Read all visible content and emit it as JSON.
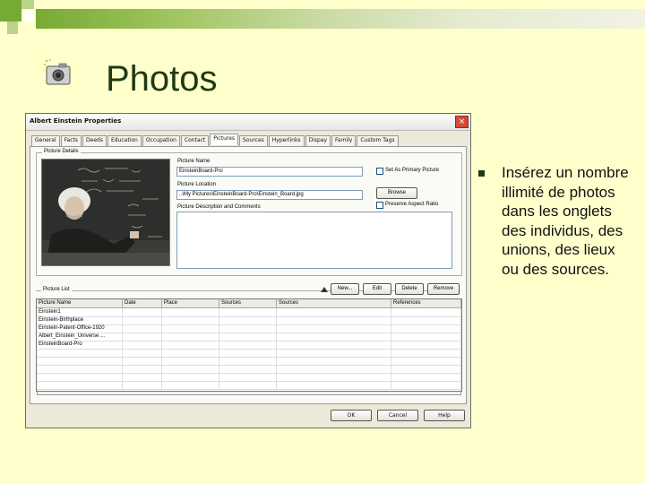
{
  "slide": {
    "title": "Photos",
    "bullet": "Insérez un nombre illimité de photos dans les onglets des individus, des unions, des lieux ou des sources."
  },
  "dialog": {
    "title": "Albert Einstein Properties",
    "close_label": "×",
    "tabs": [
      "General",
      "Facts",
      "Deeds",
      "Education",
      "Occupation",
      "Contact",
      "Pictures",
      "Sources",
      "Hyperlinks",
      "Dispay",
      "Family",
      "Custom Tags"
    ],
    "active_tab": "Pictures",
    "picture_details_label": "Picture Details",
    "picture_name_label": "Picture Name",
    "picture_name_value": "EinsteinBoard-Pro",
    "set_primary_label": "Set As Primary Picture",
    "picture_location_label": "Picture Location",
    "picture_location_value": "..\\My Pictures\\EinsteinBoard-Pro\\Einstein_Board.jpg",
    "browse_label": "Browse",
    "picture_description_label": "Picture Description and Comments",
    "preserve_label": "Preserve Aspect Ratio",
    "picture_list_label": "Picture List",
    "new_label": "New...",
    "edit_label": "Edit",
    "delete_label": "Delete",
    "remove_label": "Remove",
    "columns": [
      "Picture Name",
      "Date",
      "Place",
      "Sources",
      "Sources",
      "References"
    ],
    "rows": [
      "Einstein1",
      "Einstein-Birthplace",
      "Einstein-Patent-Office-1920",
      "Albert_Einstein_Universe ...",
      "EinsteinBoard-Pro"
    ],
    "ok_label": "OK",
    "cancel_label": "Cancel",
    "help_label": "Help"
  }
}
